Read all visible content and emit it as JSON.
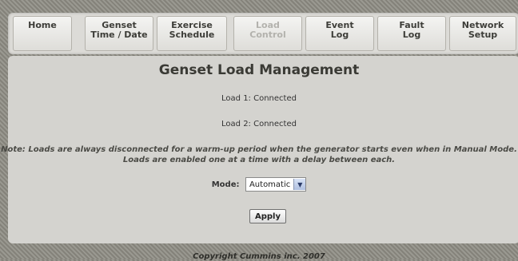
{
  "nav": {
    "tabs": [
      {
        "label": "Home",
        "disabled": false
      },
      {
        "label": "Genset\nTime / Date",
        "disabled": false
      },
      {
        "label": "Exercise\nSchedule",
        "disabled": false
      },
      {
        "label": "Load\nControl",
        "disabled": true
      },
      {
        "label": "Event\nLog",
        "disabled": false
      },
      {
        "label": "Fault\nLog",
        "disabled": false
      },
      {
        "label": "Network\nSetup",
        "disabled": false
      }
    ]
  },
  "main": {
    "title": "Genset Load Management",
    "load1": "Load 1: Connected",
    "load2": "Load 2: Connected",
    "note_line1": "Note: Loads are always disconnected for a warm-up period when the generator starts even when in Manual Mode.",
    "note_line2": "Loads are enabled one at a time with a delay between each.",
    "mode_label": "Mode:",
    "mode_value": "Automatic",
    "apply_label": "Apply"
  },
  "footer": {
    "copyright": "Copyright Cummins inc. 2007"
  }
}
